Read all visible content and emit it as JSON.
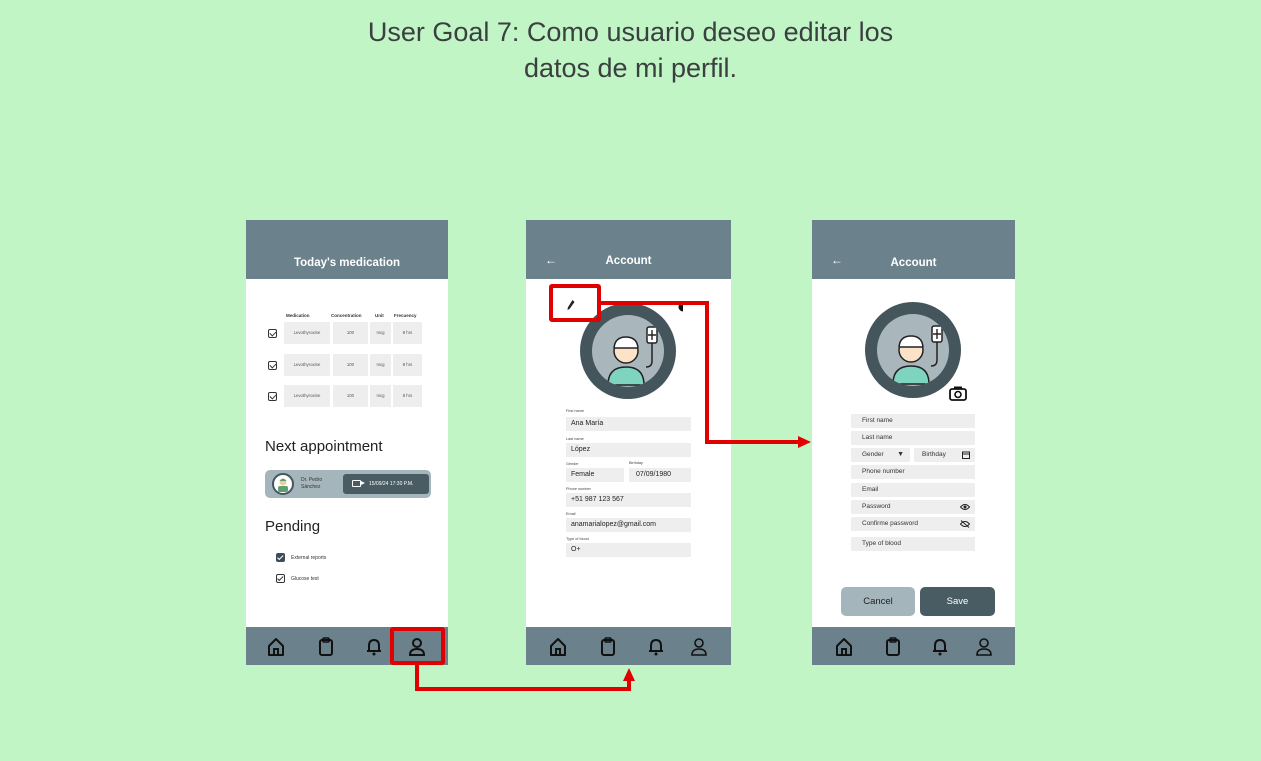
{
  "title": {
    "line1": "User Goal 7: Como usuario deseo editar los",
    "line2": "datos de mi perfil."
  },
  "screen1": {
    "header_title": "Today's medication",
    "columns": [
      "Medication",
      "Concentration",
      "Unit",
      "Frecuency"
    ],
    "rows": [
      {
        "medication": "Levothyroxine",
        "concentration": "100",
        "unit": "mcg",
        "frequency": "8 hrs"
      },
      {
        "medication": "Levothyroxine",
        "concentration": "100",
        "unit": "mcg",
        "frequency": "8 hrs"
      },
      {
        "medication": "Levothyroxine",
        "concentration": "100",
        "unit": "mcg",
        "frequency": "8 hrs"
      }
    ],
    "next_appointment_title": "Next appointment",
    "appointment": {
      "doctor": "Dr. Pedro Sánchez",
      "datetime": "15/09/24 17:30 P.M."
    },
    "pending_title": "Pending",
    "pending": [
      {
        "label": "External reports",
        "checked": true
      },
      {
        "label": "Glucose test",
        "checked": false
      }
    ]
  },
  "screen2": {
    "back": "←",
    "header_title": "Account",
    "fields": {
      "first_name_label": "First name",
      "first_name": "Ana María",
      "last_name_label": "Last name",
      "last_name": "López",
      "gender_label": "Gender",
      "gender": "Female",
      "birthday_label": "Birthday",
      "birthday": "07/09/1980",
      "phone_label": "Phone number",
      "phone": "+51 987 123 567",
      "email_label": "Email",
      "email": "anamarialopez@gmail.com",
      "blood_label": "Type of blood",
      "blood": "O+"
    }
  },
  "screen3": {
    "back": "←",
    "header_title": "Account",
    "placeholders": {
      "first_name": "First name",
      "last_name": "Last name",
      "gender": "Gender",
      "birthday": "Birthday",
      "phone": "Phone number",
      "email": "Email",
      "password": "Password",
      "confirm_password": "Confirme password",
      "blood": "Type of blood"
    },
    "cancel": "Cancel",
    "save": "Save"
  },
  "colors": {
    "background": "#c1f5c6",
    "header": "#6b818b",
    "accent_dark": "#44555c",
    "highlight": "#e00000"
  },
  "icons": {
    "nav": [
      "home-icon",
      "clipboard-icon",
      "bell-icon",
      "user-icon"
    ]
  }
}
